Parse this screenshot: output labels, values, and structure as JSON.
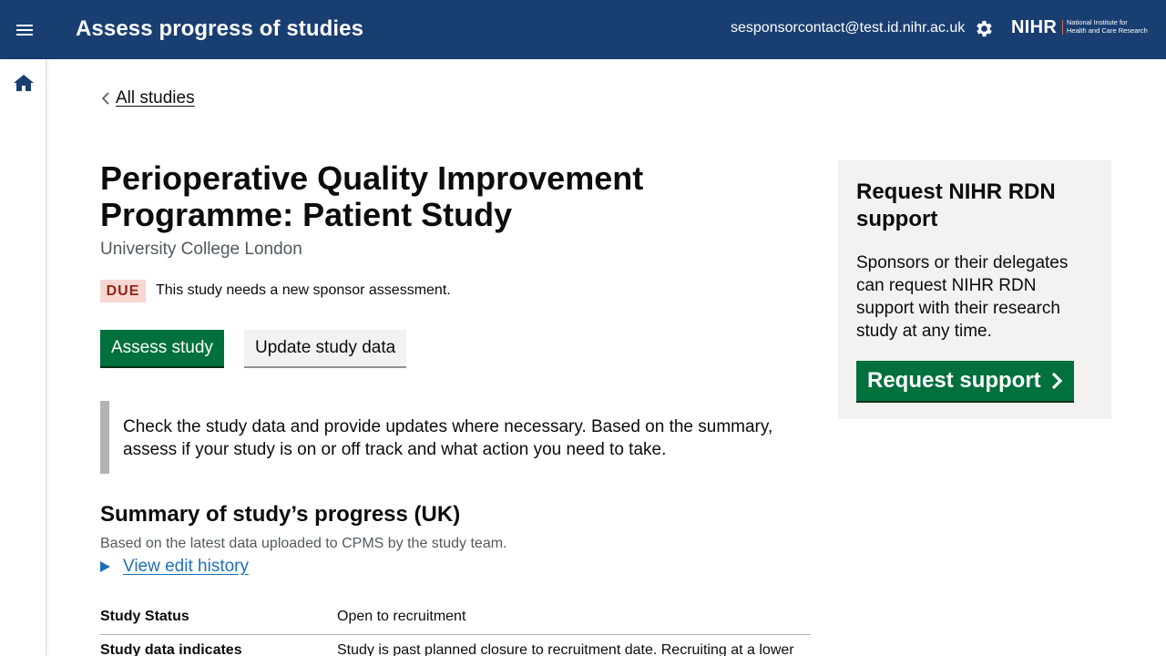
{
  "header": {
    "app_title": "Assess progress of studies",
    "user_email": "sesponsorcontact@test.id.nihr.ac.uk",
    "menu_icon": "hamburger-menu-icon",
    "settings_icon": "gear-icon",
    "logo": {
      "mark": "NIHR",
      "full_line1": "National Institute for",
      "full_line2": "Health and Care Research"
    },
    "background_color": "#193e72"
  },
  "sidenav": {
    "home_icon": "home-icon"
  },
  "breadcrumb": {
    "back_label": "All studies"
  },
  "study": {
    "title": "Perioperative Quality Improvement Programme: Patient Study",
    "organisation": "University College London",
    "status_tag": "DUE",
    "status_message": "This study needs a new sponsor assessment."
  },
  "actions": {
    "assess_label": "Assess study",
    "update_label": "Update study data"
  },
  "inset_text": "Check the study data and provide updates where necessary. Based on the summary, assess if your study is on or off track and what action you need to take.",
  "summary": {
    "heading": "Summary of study’s progress (UK)",
    "subheading": "Based on the latest data uploaded to CPMS by the study team.",
    "details_label": "View edit history",
    "rows": [
      {
        "key": "Study Status",
        "value": "Open to recruitment"
      },
      {
        "key": "Study data indicates",
        "value": "Study is past planned closure to recruitment date. Recruiting at a lower"
      }
    ]
  },
  "aside": {
    "title": "Request NIHR RDN support",
    "body": "Sponsors or their delegates can request NIHR RDN support with their research study at any time.",
    "button_label": "Request support"
  },
  "colors": {
    "primary_green": "#00703c",
    "link_blue": "#1d70b8",
    "due_bg": "#f6d7d2",
    "due_text": "#942514"
  }
}
